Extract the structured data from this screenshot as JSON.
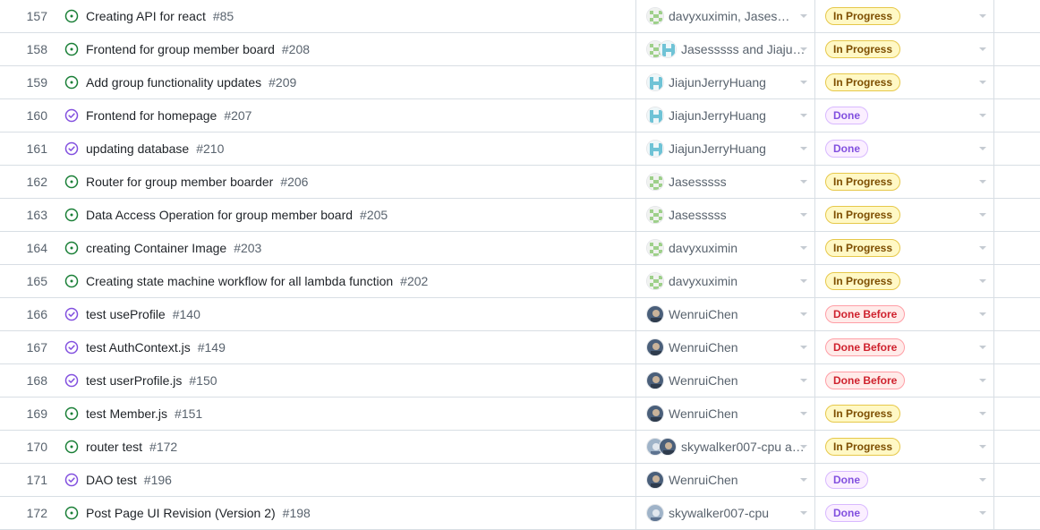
{
  "colors": {
    "open_icon": "#1a7f37",
    "closed_icon": "#8250df",
    "in_progress_bg": "#fff8c5",
    "done_bg": "#fbefff",
    "done_before_bg": "#ffebe9"
  },
  "rows": [
    {
      "num": "157",
      "state": "open",
      "title": "Creating API for react",
      "issue": "#85",
      "assignee": "davyxuximin, Jasess…",
      "avatars": [
        "green"
      ],
      "status": "In Progress",
      "status_kind": "inprogress"
    },
    {
      "num": "158",
      "state": "open",
      "title": "Frontend for group member board",
      "issue": "#208",
      "assignee": "Jasesssss and Jiajun…",
      "avatars": [
        "green",
        "cyan"
      ],
      "status": "In Progress",
      "status_kind": "inprogress"
    },
    {
      "num": "159",
      "state": "open",
      "title": "Add group functionality updates",
      "issue": "#209",
      "assignee": "JiajunJerryHuang",
      "avatars": [
        "cyan"
      ],
      "status": "In Progress",
      "status_kind": "inprogress"
    },
    {
      "num": "160",
      "state": "closed",
      "title": "Frontend for homepage",
      "issue": "#207",
      "assignee": "JiajunJerryHuang",
      "avatars": [
        "cyan"
      ],
      "status": "Done",
      "status_kind": "done"
    },
    {
      "num": "161",
      "state": "closed",
      "title": "updating database",
      "issue": "#210",
      "assignee": "JiajunJerryHuang",
      "avatars": [
        "cyan"
      ],
      "status": "Done",
      "status_kind": "done"
    },
    {
      "num": "162",
      "state": "open",
      "title": "Router for group member boarder",
      "issue": "#206",
      "assignee": "Jasesssss",
      "avatars": [
        "green"
      ],
      "status": "In Progress",
      "status_kind": "inprogress"
    },
    {
      "num": "163",
      "state": "open",
      "title": "Data Access Operation for group member board",
      "issue": "#205",
      "assignee": "Jasesssss",
      "avatars": [
        "green"
      ],
      "status": "In Progress",
      "status_kind": "inprogress"
    },
    {
      "num": "164",
      "state": "open",
      "title": "creating Container Image",
      "issue": "#203",
      "assignee": "davyxuximin",
      "avatars": [
        "green"
      ],
      "status": "In Progress",
      "status_kind": "inprogress"
    },
    {
      "num": "165",
      "state": "open",
      "title": "Creating state machine workflow for all lambda function",
      "issue": "#202",
      "assignee": "davyxuximin",
      "avatars": [
        "green"
      ],
      "status": "In Progress",
      "status_kind": "inprogress"
    },
    {
      "num": "166",
      "state": "closed",
      "title": "test useProfile",
      "issue": "#140",
      "assignee": "WenruiChen",
      "avatars": [
        "photo"
      ],
      "status": "Done Before",
      "status_kind": "donebefore"
    },
    {
      "num": "167",
      "state": "closed",
      "title": "test AuthContext.js",
      "issue": "#149",
      "assignee": "WenruiChen",
      "avatars": [
        "photo"
      ],
      "status": "Done Before",
      "status_kind": "donebefore"
    },
    {
      "num": "168",
      "state": "closed",
      "title": "test userProfile.js",
      "issue": "#150",
      "assignee": "WenruiChen",
      "avatars": [
        "photo"
      ],
      "status": "Done Before",
      "status_kind": "donebefore"
    },
    {
      "num": "169",
      "state": "open",
      "title": "test Member.js",
      "issue": "#151",
      "assignee": "WenruiChen",
      "avatars": [
        "photo"
      ],
      "status": "In Progress",
      "status_kind": "inprogress"
    },
    {
      "num": "170",
      "state": "open",
      "title": "router test",
      "issue": "#172",
      "assignee": "skywalker007-cpu a…",
      "avatars": [
        "photo2",
        "photo"
      ],
      "status": "In Progress",
      "status_kind": "inprogress"
    },
    {
      "num": "171",
      "state": "closed",
      "title": "DAO test",
      "issue": "#196",
      "assignee": "WenruiChen",
      "avatars": [
        "photo"
      ],
      "status": "Done",
      "status_kind": "done"
    },
    {
      "num": "172",
      "state": "open",
      "title": "Post Page UI Revision (Version 2)",
      "issue": "#198",
      "assignee": "skywalker007-cpu",
      "avatars": [
        "photo2"
      ],
      "status": "Done",
      "status_kind": "done"
    }
  ]
}
